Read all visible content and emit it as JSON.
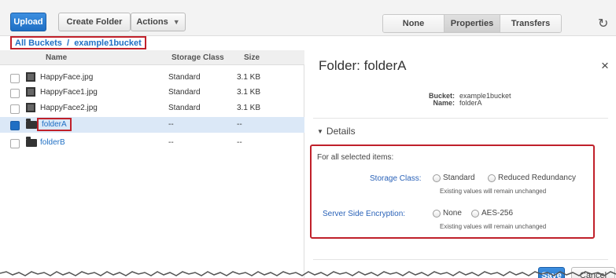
{
  "toolbar": {
    "upload_label": "Upload",
    "create_folder_label": "Create Folder",
    "actions_label": "Actions",
    "view_tabs": [
      "None",
      "Properties",
      "Transfers"
    ],
    "accent_color": "#1f6fc4"
  },
  "breadcrumb": {
    "text": "All Buckets  /  example1bucket"
  },
  "file_list": {
    "columns": [
      "Name",
      "Storage Class",
      "Size"
    ],
    "rows": [
      {
        "name": "HappyFace.jpg",
        "storage_class": "Standard",
        "size": "3.1 KB",
        "type": "file",
        "selected": false
      },
      {
        "name": "HappyFace1.jpg",
        "storage_class": "Standard",
        "size": "3.1 KB",
        "type": "file",
        "selected": false
      },
      {
        "name": "HappyFace2.jpg",
        "storage_class": "Standard",
        "size": "3.1 KB",
        "type": "file",
        "selected": false
      },
      {
        "name": "folderA",
        "storage_class": "--",
        "size": "--",
        "type": "folder",
        "selected": true
      },
      {
        "name": "folderB",
        "storage_class": "--",
        "size": "--",
        "type": "folder",
        "selected": false
      }
    ]
  },
  "properties": {
    "title": "Folder: folderA",
    "close_symbol": "×",
    "bucket_label": "Bucket:",
    "bucket_value": "example1bucket",
    "name_label": "Name:",
    "name_value": "folderA",
    "details_label": "Details",
    "for_all_label": "For all selected items:",
    "storage_class_label": "Storage Class:",
    "storage_class_options": [
      "Standard",
      "Reduced Redundancy"
    ],
    "storage_class_note": "Existing values will remain unchanged",
    "encryption_label": "Server Side Encryption:",
    "encryption_options": [
      "None",
      "AES-256"
    ],
    "encryption_note": "Existing values will remain unchanged",
    "save_label": "Save",
    "cancel_label": "Cancel"
  }
}
